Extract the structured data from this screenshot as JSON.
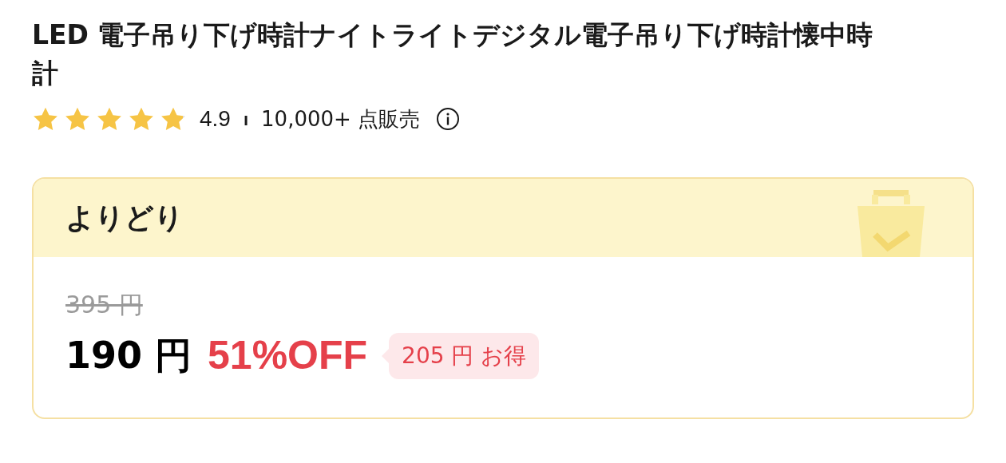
{
  "product": {
    "title": "LED 電子吊り下げ時計ナイトライトデジタル電子吊り下げ時計懐中時計"
  },
  "rating": {
    "stars": 4.9,
    "score": "4.9",
    "separator": "ı",
    "sold": "10,000+ 点販売"
  },
  "deal": {
    "title": "よりどり",
    "original_price": "395 円",
    "price": "190 円",
    "discount": "51%OFF",
    "savings": "205 円 お得"
  }
}
